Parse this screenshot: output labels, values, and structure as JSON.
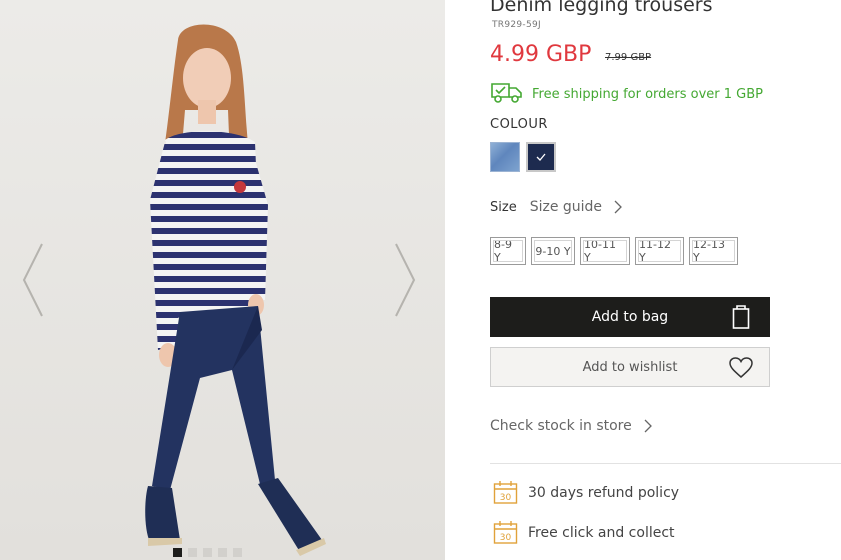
{
  "product": {
    "title": "Denim legging trousers",
    "sku": "TR929-59J",
    "price": "4.99 GBP",
    "old_price": "7.99 GBP"
  },
  "shipping": {
    "text": "Free shipping for orders over 1 GBP",
    "icon": "truck-icon",
    "color": "#44a832"
  },
  "colour": {
    "label": "COLOUR",
    "swatches": [
      {
        "name": "light-denim",
        "selected": false
      },
      {
        "name": "navy",
        "selected": true
      }
    ]
  },
  "size": {
    "label": "Size",
    "guide_label": "Size guide",
    "options": [
      "8-9 Y",
      "9-10 Y",
      "10-11 Y",
      "11-12 Y",
      "12-13 Y"
    ]
  },
  "actions": {
    "add_to_bag": "Add to bag",
    "add_to_wishlist": "Add to wishlist"
  },
  "stock": {
    "label": "Check stock in store"
  },
  "features": [
    {
      "icon_text": "30",
      "label": "30 days refund policy"
    },
    {
      "icon_text": "30",
      "label": "Free click and collect"
    }
  ],
  "gallery": {
    "image_count": 5,
    "active_index": 0
  },
  "colors": {
    "price": "#e0383e",
    "button_dark": "#1d1d1b",
    "feature_icon": "#e0a23a"
  }
}
